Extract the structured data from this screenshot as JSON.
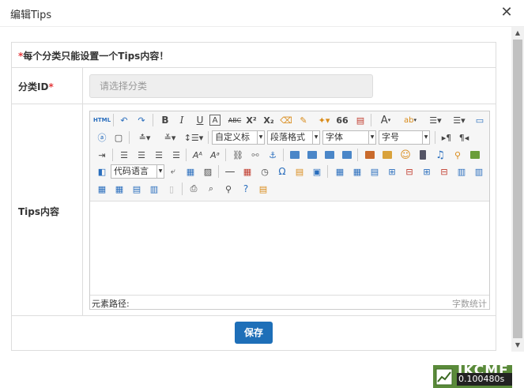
{
  "dialog": {
    "title": "编辑Tips",
    "close_icon": "close-icon"
  },
  "form": {
    "notice_star": "*",
    "notice": "每个分类只能设置一个Tips内容！",
    "category": {
      "label": "分类ID",
      "required": "*",
      "placeholder": "请选择分类"
    },
    "tips": {
      "label": "Tips内容"
    },
    "save_label": "保存"
  },
  "editor": {
    "toolbar": {
      "html_label": "HTML",
      "combos": {
        "custom_title": "自定义标",
        "paragraph": "段落格式",
        "font_family": "字体",
        "font_size": "字号",
        "code_language": "代码语言"
      },
      "text_buttons": {
        "bold": "B",
        "italic": "I",
        "underline": "U",
        "border": "A",
        "strike": "ABC",
        "superscript": "X²",
        "subscript": "X₂",
        "quote": "66",
        "font_color": "A",
        "bg_color": "ab"
      }
    },
    "statusbar": {
      "path": "元素路径:",
      "wordcount": "字数统计"
    }
  },
  "badge": {
    "logo": "IKCMF",
    "time": "0.100480s"
  },
  "colors": {
    "accent": "#1e6fb8",
    "required": "#e4393c",
    "badge": "#5a8a3a"
  }
}
